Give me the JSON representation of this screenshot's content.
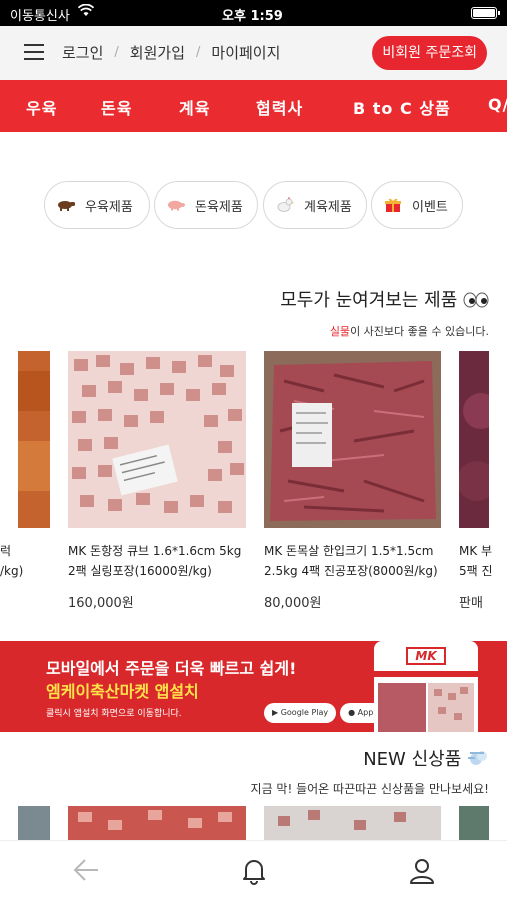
{
  "status": {
    "carrier": "이동통신사",
    "time": "오후 1:59"
  },
  "topbar": {
    "links": [
      "로그인",
      "회원가입",
      "마이페이지"
    ],
    "order_button": "비회원 주문조회"
  },
  "categories": [
    "우육",
    "돈육",
    "계육",
    "협력사",
    "B to C 상품",
    "Q/"
  ],
  "chips": [
    {
      "label": "우육제품",
      "icon": "cow-icon"
    },
    {
      "label": "돈육제품",
      "icon": "pig-icon"
    },
    {
      "label": "계육제품",
      "icon": "chicken-icon"
    },
    {
      "label": "이벤트",
      "icon": "gift-icon"
    }
  ],
  "featured": {
    "title": "모두가 눈여겨보는 제품",
    "subtitle_red": "실물",
    "subtitle_rest": "이 사진보다 좋을 수 있습니다."
  },
  "products": [
    {
      "name": "럭\n/kg)",
      "price": ""
    },
    {
      "name": "MK 돈항정 큐브 1.6*1.6cm 5kg\n2팩 실링포장(16000원/kg)",
      "price": "160,000원"
    },
    {
      "name": "MK 돈목살 한입크기 1.5*1.5cm\n2.5kg 4팩 진공포장(8000원/kg)",
      "price": "80,000원"
    },
    {
      "name": "MK 부\n5팩 진",
      "price": "판매"
    }
  ],
  "banner": {
    "line1": "모바일에서 주문을 더욱 빠르고 쉽게!",
    "line2": "엠케이축산마켓 앱설치",
    "line3": "클릭시 앱설치 화면으로 이동합니다.",
    "google_play": "Google Play",
    "app_store": "App Store",
    "logo": "MK"
  },
  "new_section": {
    "title": "NEW 신상품",
    "subtitle": "지금 막! 들어온 따끈따끈 신상품을 만나보세요!"
  },
  "colors": {
    "brand_red": "#ea2b2f",
    "banner_red": "#d8282b",
    "banner_yellow": "#ffe14a"
  }
}
